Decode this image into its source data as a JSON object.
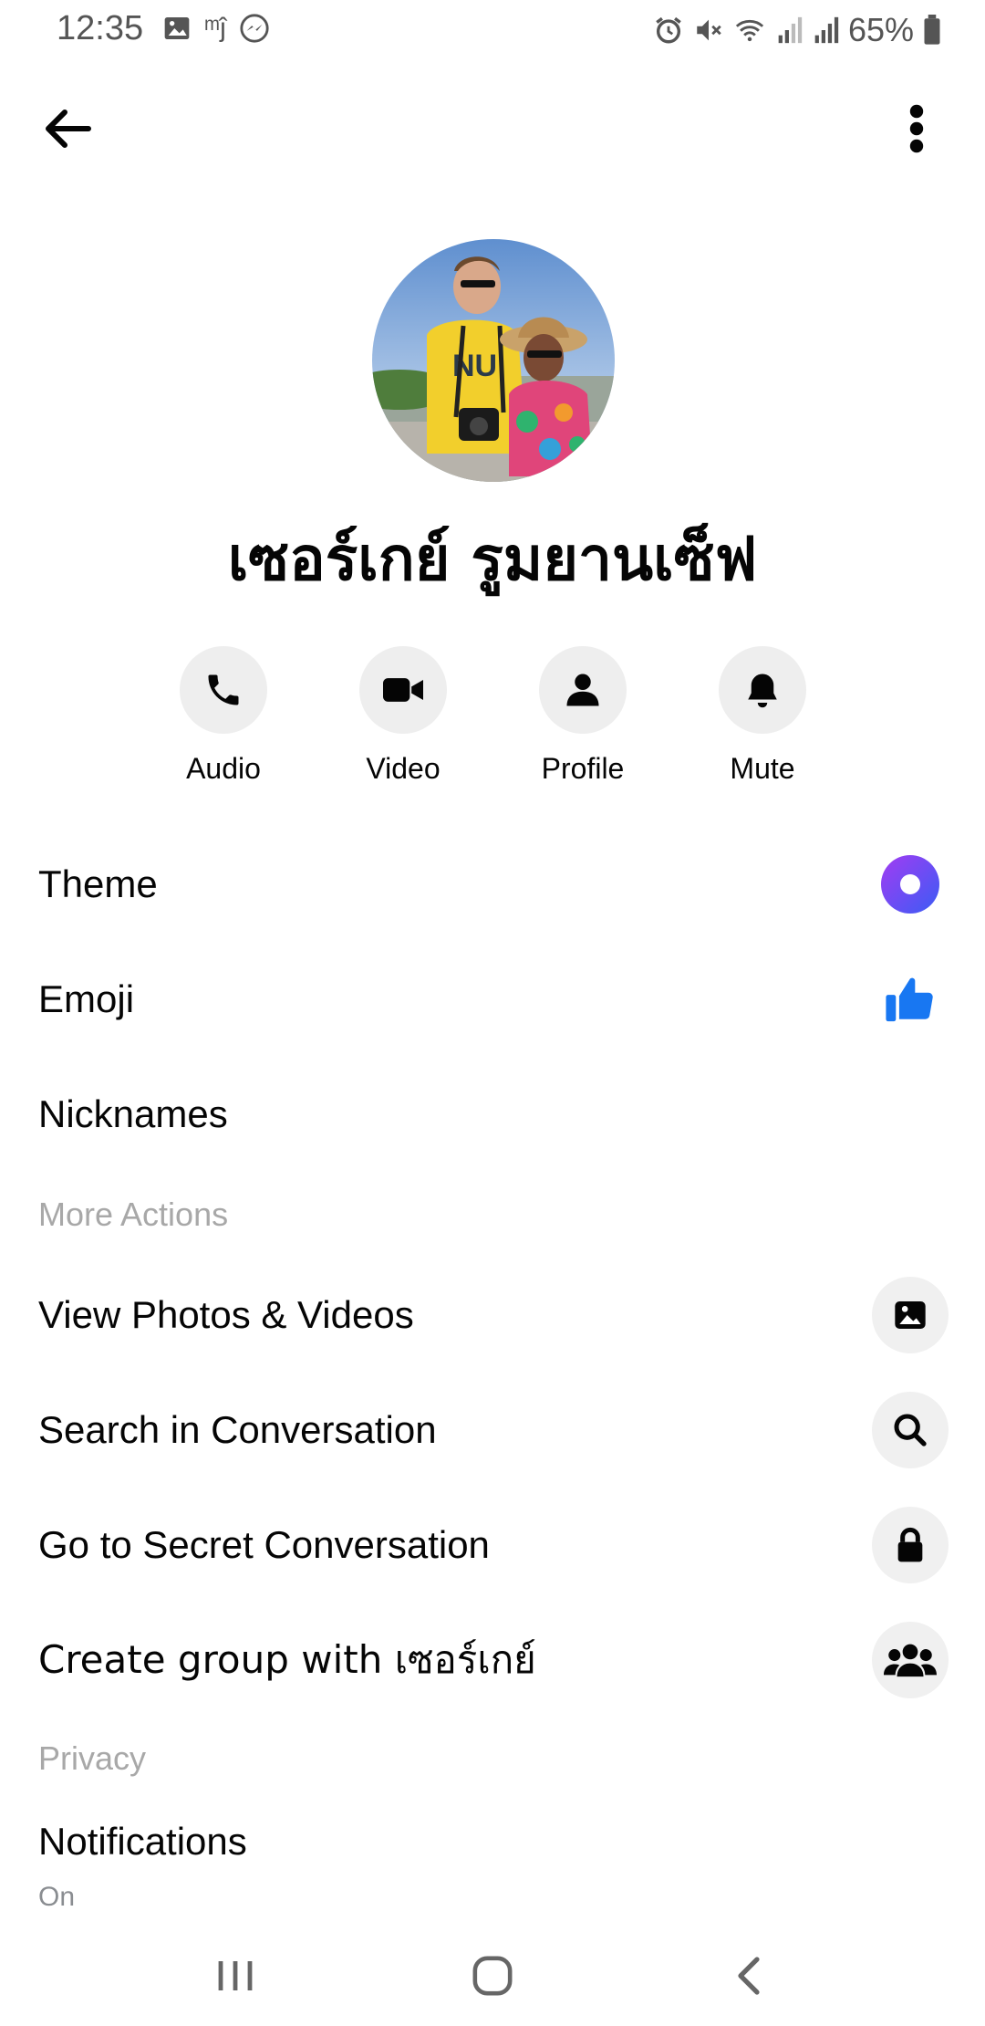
{
  "status_bar": {
    "time": "12:35",
    "battery_percent": "65%"
  },
  "contact": {
    "name": "เซอร์เกย์ รูมยานเซ็ฟ"
  },
  "actions": [
    {
      "label": "Audio",
      "icon": "phone-icon"
    },
    {
      "label": "Video",
      "icon": "video-camera-icon"
    },
    {
      "label": "Profile",
      "icon": "person-icon"
    },
    {
      "label": "Mute",
      "icon": "bell-icon"
    }
  ],
  "customization": {
    "theme_label": "Theme",
    "theme_color": "#5b3cf5",
    "emoji_label": "Emoji",
    "emoji_color": "#1877f2",
    "nicknames_label": "Nicknames"
  },
  "more_actions": {
    "header": "More Actions",
    "items": [
      {
        "label": "View Photos & Videos",
        "icon": "photo-icon"
      },
      {
        "label": "Search in Conversation",
        "icon": "search-icon"
      },
      {
        "label": "Go to Secret Conversation",
        "icon": "lock-icon"
      },
      {
        "label": "Create group with เซอร์เกย์",
        "icon": "group-icon"
      }
    ]
  },
  "privacy": {
    "header": "Privacy",
    "notifications_label": "Notifications",
    "notifications_value": "On"
  }
}
